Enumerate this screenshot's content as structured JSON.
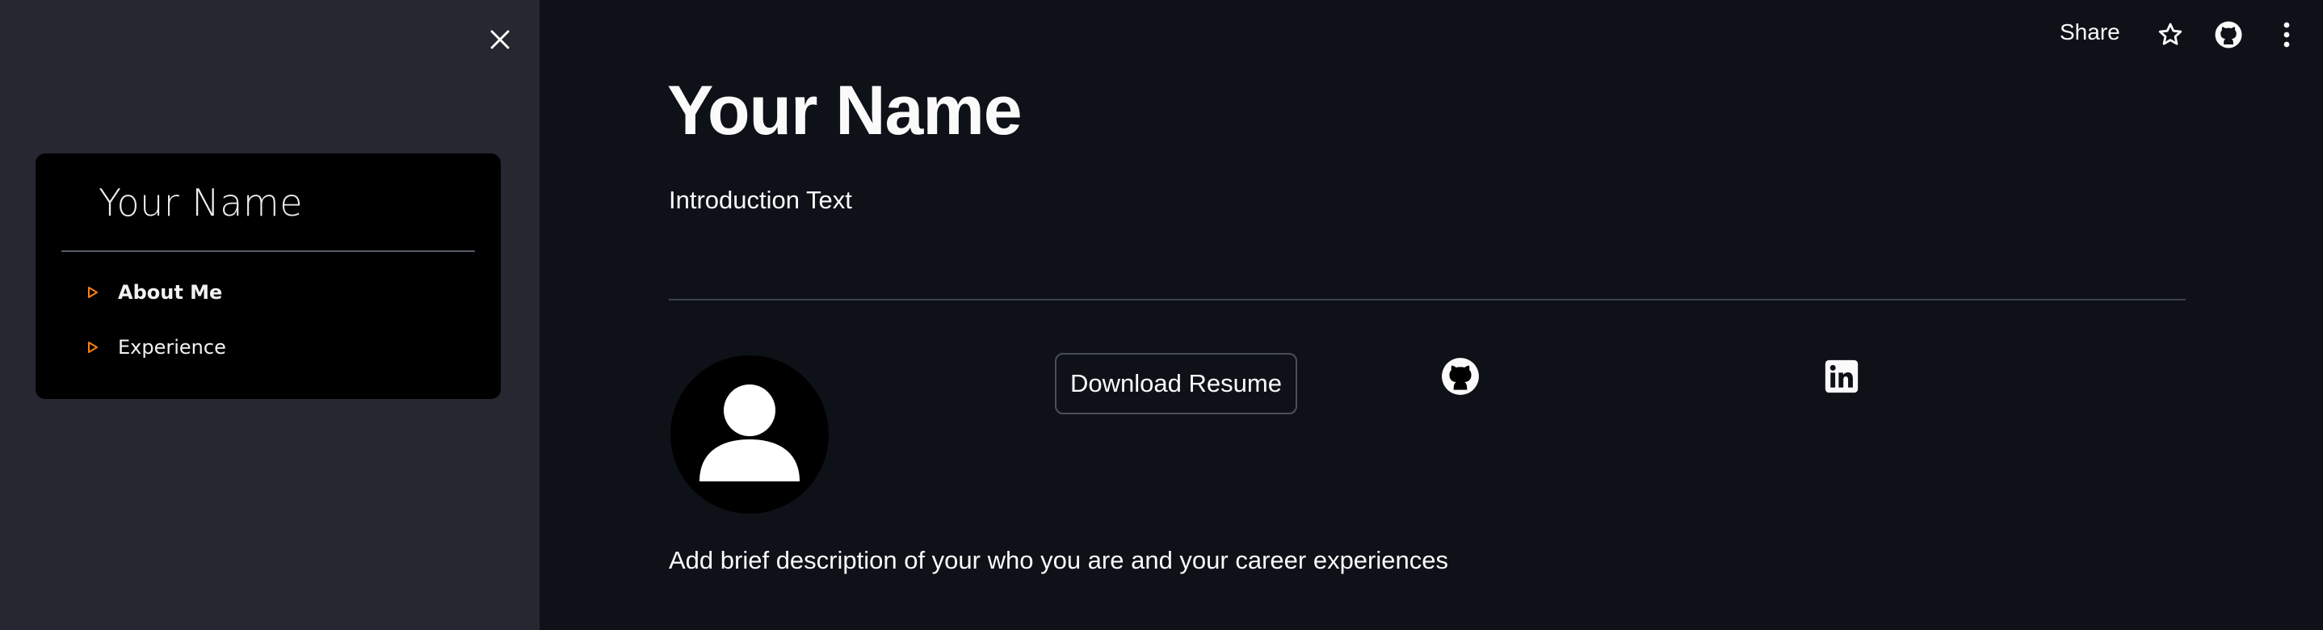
{
  "sidebar": {
    "close_icon": "close-icon",
    "nav_title": "Your Name",
    "items": [
      {
        "label": "About Me",
        "active": true,
        "icon": "triangle-right-icon"
      },
      {
        "label": "Experience",
        "active": false,
        "icon": "triangle-right-icon"
      }
    ],
    "accent_color": "#ff7f0e"
  },
  "toolbar": {
    "share_label": "Share",
    "icons": [
      "star-icon",
      "github-icon",
      "more-vertical-icon"
    ]
  },
  "main": {
    "title": "Your Name",
    "intro": "Introduction Text",
    "download_label": "Download Resume",
    "social_icons": [
      "github-icon",
      "linkedin-icon"
    ],
    "description": "Add brief description of your who you are and your career experiences"
  },
  "colors": {
    "background": "#0e1117",
    "sidebar": "#262730",
    "text": "#fafafa"
  }
}
